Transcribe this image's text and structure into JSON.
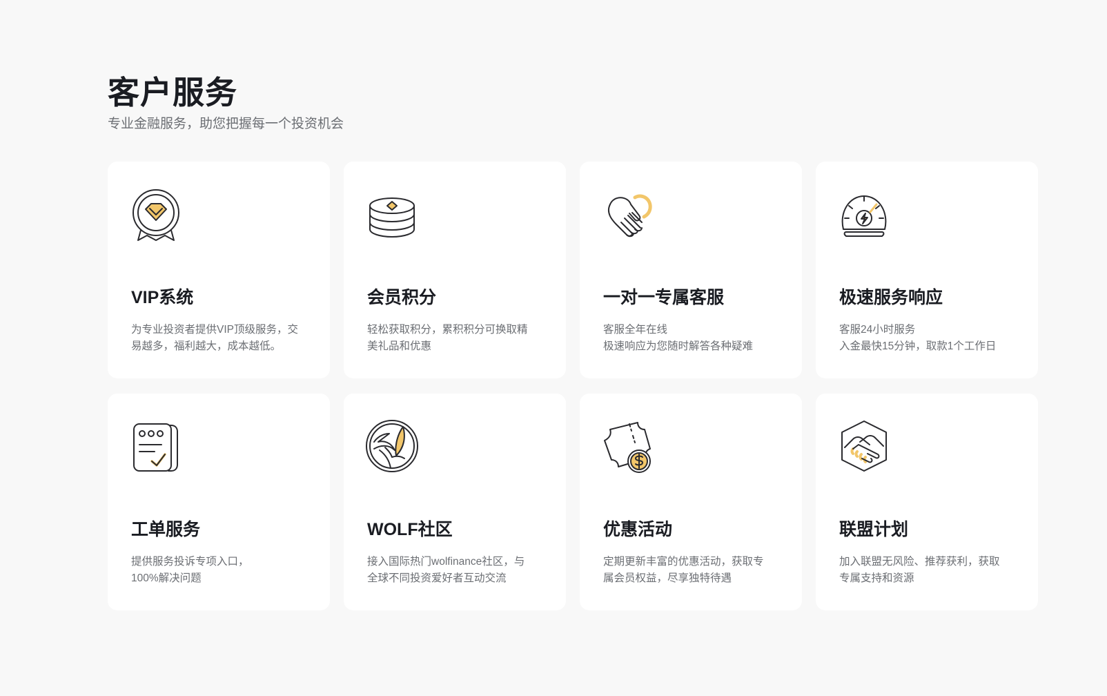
{
  "section": {
    "title": "客户服务",
    "subtitle": "专业金融服务，助您把握每一个投资机会"
  },
  "colors": {
    "accent": "#f2c66a",
    "stroke": "#2a2a2e",
    "background": "#f8f8f8",
    "card": "#ffffff"
  },
  "cards": [
    {
      "icon": "vip-badge-icon",
      "title": "VIP系统",
      "desc_line1": "为专业投资者提供VIP顶级服务，交",
      "desc_line2": "易越多，福利越大，成本越低。"
    },
    {
      "icon": "coin-stack-icon",
      "title": "会员积分",
      "desc_line1": "轻松获取积分，累积积分可换取精",
      "desc_line2": "美礼品和优惠"
    },
    {
      "icon": "heart-hand-icon",
      "title": "一对一专属客服",
      "desc_line1": "客服全年在线",
      "desc_line2": "极速响应为您随时解答各种疑难"
    },
    {
      "icon": "speedometer-icon",
      "title": "极速服务响应",
      "desc_line1": "客服24小时服务",
      "desc_line2": "入金最快15分钟，取款1个工作日"
    },
    {
      "icon": "ticket-form-icon",
      "title": "工单服务",
      "desc_line1": "提供服务投诉专项入口，",
      "desc_line2": "100%解决问题"
    },
    {
      "icon": "wolf-community-icon",
      "title": "WOLF社区",
      "desc_line1": "接入国际热门wolfinance社区，与",
      "desc_line2": "全球不同投资爱好者互动交流"
    },
    {
      "icon": "coupon-dollar-icon",
      "title": "优惠活动",
      "desc_line1": "定期更新丰富的优惠活动，获取专",
      "desc_line2": "属会员权益，尽享独特待遇"
    },
    {
      "icon": "handshake-icon",
      "title": "联盟计划",
      "desc_line1": "加入联盟无风险、推荐获利，获取",
      "desc_line2": "专属支持和资源"
    }
  ]
}
